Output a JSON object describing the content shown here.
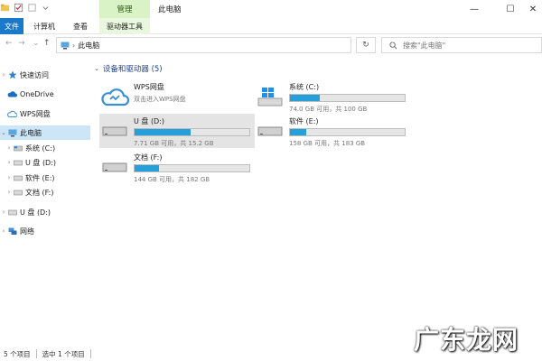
{
  "titlebar": {
    "context_tab": "管理",
    "window_title": "此电脑",
    "controls": {
      "minimize": "—",
      "maximize": "☐",
      "close": "✕"
    }
  },
  "ribbon": {
    "tabs": [
      "文件",
      "计算机",
      "查看",
      "驱动器工具"
    ]
  },
  "address": {
    "back": "←",
    "forward": "→",
    "dropdown": "⌄",
    "up": "↑",
    "path": "此电脑",
    "refresh": "↻",
    "search_placeholder": "搜索\"此电脑\""
  },
  "sidebar": {
    "items": [
      {
        "label": "快速访问",
        "icon": "star-icon"
      },
      {
        "label": "OneDrive",
        "icon": "cloud-icon"
      },
      {
        "label": "WPS网盘",
        "icon": "wps-cloud-icon"
      },
      {
        "label": "此电脑",
        "icon": "computer-icon"
      },
      {
        "label": "系统 (C:)",
        "icon": "drive-icon"
      },
      {
        "label": "U 盘 (D:)",
        "icon": "usb-drive-icon"
      },
      {
        "label": "软件 (E:)",
        "icon": "drive-icon"
      },
      {
        "label": "文档 (F:)",
        "icon": "drive-icon"
      },
      {
        "label": "U 盘 (D:)",
        "icon": "usb-drive-icon"
      },
      {
        "label": "网络",
        "icon": "network-icon"
      }
    ]
  },
  "main": {
    "group_title": "设备和驱动器 (5)",
    "tiles": [
      {
        "name": "WPS网盘",
        "sub": "双击进入WPS网盘",
        "icon": "wps-cloud-icon"
      },
      {
        "name": "系统 (C:)",
        "sub": "74.0 GB 可用，共 100 GB",
        "usage": 0.26,
        "icon": "windows-drive-icon"
      },
      {
        "name": "U 盘 (D:)",
        "sub": "7.71 GB 可用，共 15.2 GB",
        "usage": 0.49,
        "icon": "usb-drive-icon"
      },
      {
        "name": "软件 (E:)",
        "sub": "158 GB 可用，共 183 GB",
        "usage": 0.14,
        "icon": "drive-icon"
      },
      {
        "name": "文档 (F:)",
        "sub": "144 GB 可用，共 182 GB",
        "usage": 0.21,
        "icon": "drive-icon"
      }
    ]
  },
  "status": {
    "count": "5 个项目",
    "selected": "选中 1 个项目"
  },
  "watermark": "广东龙网",
  "colors": {
    "accent": "#1979ca",
    "bar_fill": "#26a0da",
    "selection": "#cde6f7",
    "context_tab": "#d9f3c6"
  }
}
